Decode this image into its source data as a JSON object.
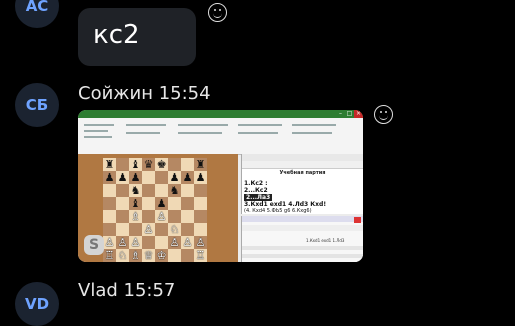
{
  "messages": [
    {
      "avatar": "АС",
      "text": "кс2"
    },
    {
      "avatar": "СБ",
      "sender": "Сойжин",
      "time": "15:54"
    },
    {
      "avatar": "VD",
      "sender": "Vlad",
      "time": "15:57"
    }
  ],
  "screenshot": {
    "panel_title": "Учебная партия",
    "moves": [
      "1.Кс2 :",
      "2...Кс2",
      "2...Ла3",
      "3.Кxd1 exd1 4.Лd3 Кxd!",
      "(4. Кxd4 5.ФЬ5 g6 6.Кхg6)"
    ],
    "side_text": "1.Кxd1 exd1 1.Лd3",
    "logo": "S"
  }
}
